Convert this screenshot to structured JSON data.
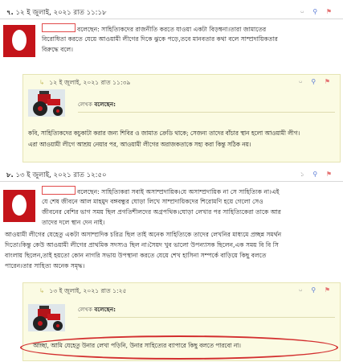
{
  "comments": [
    {
      "number": "৭.",
      "date": "১২ ই জুলাই, ২০২১ রাত ১১:১৮",
      "actions": {
        "reply_count": "০",
        "link_icon": "link-icon",
        "flag_icon": "flag-icon"
      },
      "lines": [
        "বলেছেন: সাহিত্যিকদের রাজনীতি করতে যাওয়া একটা বিড়ম্বনা।তারা জামাতের",
        "বিরোধিতা করতে যেয়ে আওয়ামী লীগের দিকে ঝুকে পড়ে,তবে মানবতার কথা বলে সাম্প্রদায়িকতার",
        "বিরুদ্ধে বলে।"
      ],
      "reply": {
        "date": "১২ ই জুলাই, ২০২১ রাত ১১:৩৯",
        "reply_count": "০",
        "author_label": "লেখক",
        "said": "বলেছেন:",
        "lines": [
          "কবি, সাহিত্যিকদের কচুকাটা করার জন্য শিবির ও জামাত ক্রেডি থাকে; সেজন্য তাদের বাঁচার স্থান হলো আওয়ামী লীগ।",
          "এরা আওয়ামী লীগে আশ্রয় নেয়ার পর, আওয়ামী লীগের অরাজকতাকে সহ্য করা কিন্তু সঠিক নয়।"
        ]
      }
    },
    {
      "number": "৮.",
      "date": "১৩ ই জুলাই, ২০২১ রাত ১২:৫০",
      "actions": {
        "reply_count": "১",
        "link_icon": "link-icon",
        "flag_icon": "flag-icon"
      },
      "lines": [
        "বলেছেন: সাহিত্যিকরা সবাই অসাম্প্রদায়িক।যে অসাম্প্রদায়িক না সে সাহিত্যিক না।এই",
        "যে শেষ জীবনে আল মাহমুদ বঙ্গবন্ধুর ঘোড়া লিখে সাম্প্রদায়িকদের শিরোমণি হয়ে গেলো সেও",
        "জীবনের বেশির ভাগ সময় ছিল প্রগতিশীলদের অগ্রপথিক।ঘোড়া লেখার পর সাহিত্যিকেরা তাকে আর",
        "তাদের দলে স্থান দেন নাই।"
      ],
      "lines_full": [
        "আওয়ামী লীগের যেহেতু একটা অসাম্প্রদিক চরিত্র ছিল তাই অনেক সাহিত্যিকে তাদের লেখনির মাধ্যমে প্রচ্ছন্ন সমর্থন",
        "দিতো।কিন্তু কেউ আওয়ামী লীগের প্রাথমিক সদস্যও ছিল না।সৈয়দ খুব ভালো উপন্যাসক ছিলেন,এক সময় বি বি সি",
        "বাংলায় ছিলেন,তাই হয়তো কোন নাগরি সভায় উপস্থানা করতে যেয়ে শেখ হাসিনা সম্পর্কে বাড়িয়ে কিছু বলতে",
        "পারেন।তার সাহিত্য অনেক সমৃদ্ধ।"
      ],
      "reply": {
        "date": "১৩ ই জুলাই, ২০২১ রাত ১:২৫",
        "reply_count": "০",
        "author_label": "লেখক",
        "said": "বলেছেন:",
        "lines": [
          "আচ্ছা, আমি যেহেতু উনার লেখা পড়িনি, উনার সাহিত্যের ব্যাপারে কিছু বলতে পারবো না।"
        ]
      }
    }
  ],
  "colors": {
    "avatar": "#c4141a",
    "reply_bg": "#fbfbe3",
    "highlight_oval": "#d32f2f"
  }
}
